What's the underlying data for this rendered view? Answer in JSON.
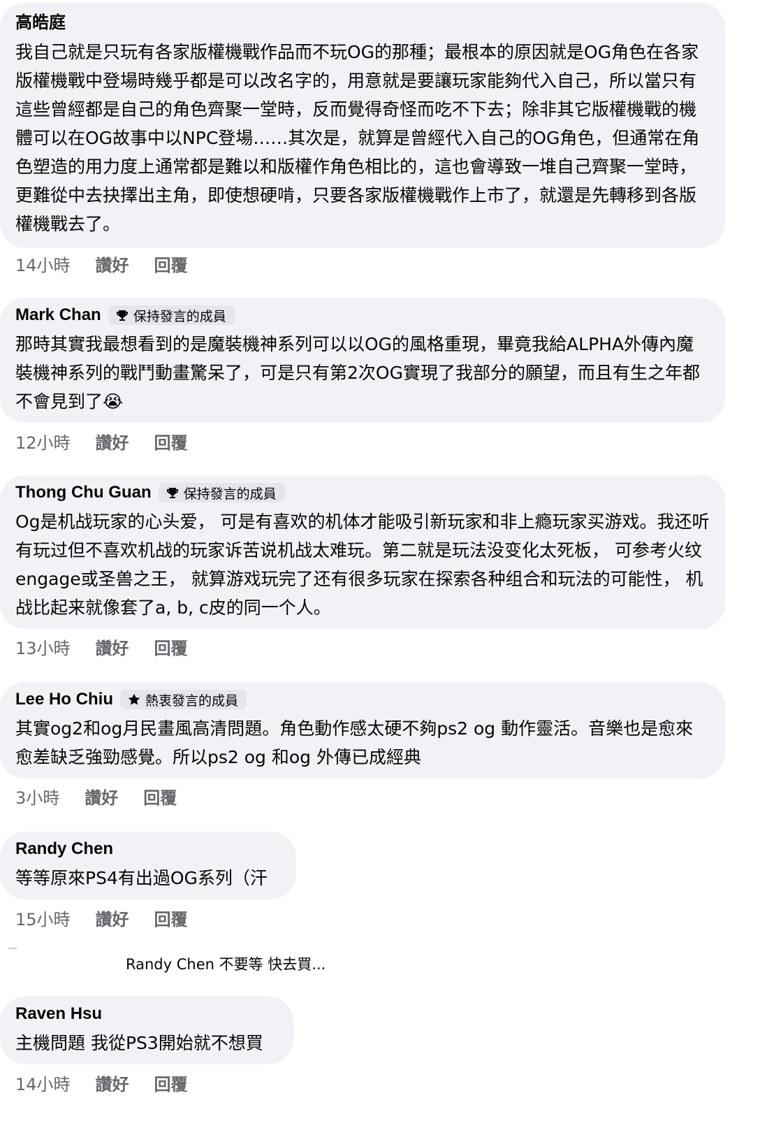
{
  "comments": [
    {
      "author": "高皓庭",
      "badge": "",
      "text": "我自己就是只玩有各家版權機戰作品而不玩OG的那種；最根本的原因就是OG角色在各家版權機戰中登場時幾乎都是可以改名字的，用意就是要讓玩家能夠代入自己，所以當只有這些曾經都是自己的角色齊聚一堂時，反而覺得奇怪而吃不下去；除非其它版權機戰的機體可以在OG故事中以NPC登場……其次是，就算是曾經代入自己的OG角色，但通常在角色塑造的用力度上通常都是難以和版權作角色相比的，這也會導致一堆自己齊聚一堂時，更難從中去抉擇出主角，即使想硬啃，只要各家版權機戰作上市了，就還是先轉移到各版權機戰去了。",
      "time": "14小時",
      "like": "讚好",
      "reply": "回覆"
    },
    {
      "author": "Mark Chan",
      "badge": "保持發言的成員",
      "badge_icon": "trophy-icon",
      "text": "那時其實我最想看到的是魔裝機神系列可以以OG的風格重現，畢竟我給ALPHA外傳內魔裝機神系列的戰鬥動畫驚呆了，可是只有第2次OG實現了我部分的願望，而且有生之年都不會見到了😭",
      "time": "12小時",
      "like": "讚好",
      "reply": "回覆"
    },
    {
      "author": "Thong Chu Guan",
      "badge": "保持發言的成員",
      "badge_icon": "trophy-icon",
      "text": "Og是机战玩家的心头爱， 可是有喜欢的机体才能吸引新玩家和非上瘾玩家买游戏。我还听有玩过但不喜欢机战的玩家诉苦说机战太难玩。第二就是玩法没变化太死板， 可参考火纹engage或圣兽之王， 就算游戏玩完了还有很多玩家在探索各种组合和玩法的可能性， 机战比起来就像套了a, b, c皮的同一个人。",
      "time": "13小時",
      "like": "讚好",
      "reply": "回覆"
    },
    {
      "author": "Lee Ho Chiu",
      "badge": "熱衷發言的成員",
      "badge_icon": "star-icon",
      "text": "其實og2和og月民畫風高清問題。角色動作感太硬不夠ps2 og 動作靈活。音樂也是愈來愈差缺乏強勁感覺。所以ps2 og 和og 外傳已成經典",
      "time": "3小時",
      "like": "讚好",
      "reply": "回覆"
    },
    {
      "author": "Randy Chen",
      "badge": "",
      "text": "等等原來PS4有出過OG系列（汗",
      "time": "15小時",
      "like": "讚好",
      "reply": "回覆"
    },
    {
      "author": "Raven Hsu",
      "badge": "",
      "text": "主機問題 我從PS3開始就不想買",
      "time": "14小時",
      "like": "讚好",
      "reply": "回覆"
    }
  ],
  "reply_preview": "Randy Chen 不要等 快去買..."
}
